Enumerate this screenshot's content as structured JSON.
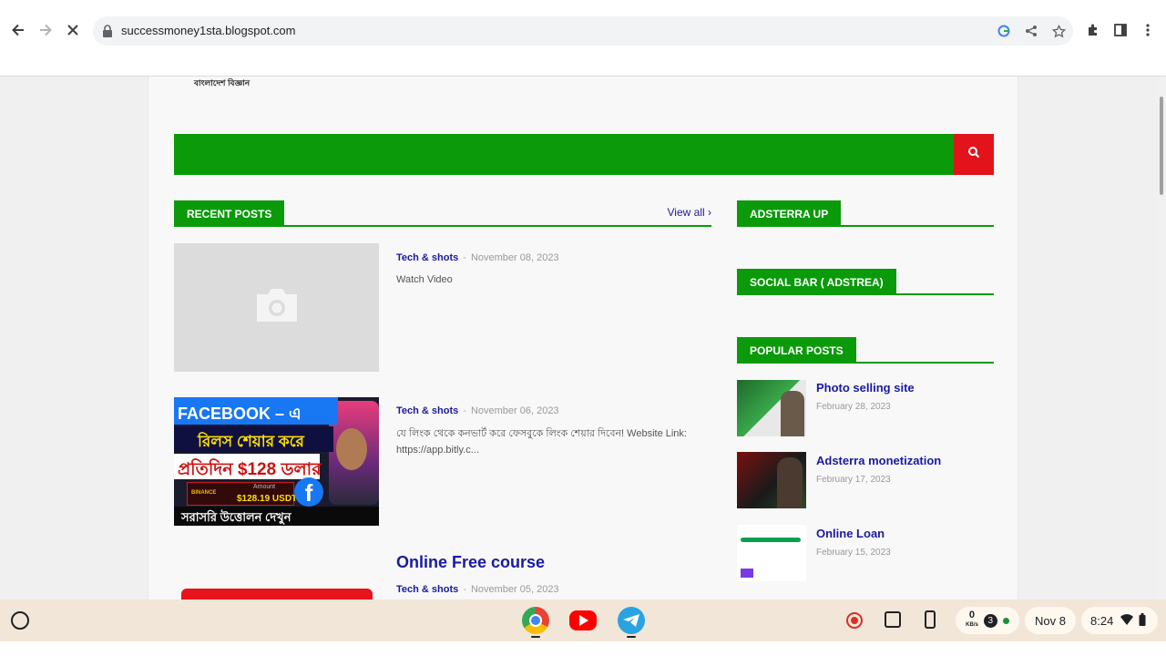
{
  "browser": {
    "url": "successmoney1sta.blogspot.com"
  },
  "site": {
    "logo_text": "বাংলাদেশ বিজ্ঞান"
  },
  "sections": {
    "recent_posts": "RECENT POSTS",
    "view_all": "View all",
    "adsterra_up": "ADSTERRA UP",
    "social_bar": "SOCIAL BAR ( ADSTREA)",
    "popular_posts": "POPULAR POSTS"
  },
  "posts": [
    {
      "category": "Tech & shots",
      "date": "November 08, 2023",
      "snippet": "Watch Video"
    },
    {
      "category": "Tech & shots",
      "date": "November 06, 2023",
      "snippet": "যে লিংক থেকে কনভার্ট করে ফেসবুকে লিংক শেয়ার দিবেন! Website Link: https://app.bitly.c..."
    },
    {
      "title": "Online Free course",
      "category": "Tech & shots",
      "date": "November 05, 2023"
    }
  ],
  "facebook_thumb": {
    "line1": "FACEBOOK – এ",
    "line2": "রিলস শেয়ার করে",
    "line3": "প্রতিদিন $128 ডলার",
    "amount_label": "Amount",
    "amount_brand": "BINANCE",
    "amount_value": "$128.19 USDT",
    "line4": "সরাসরি উত্তোলন দেখুন"
  },
  "popular": [
    {
      "title": "Photo selling site",
      "date": "February 28, 2023"
    },
    {
      "title": "Adsterra monetization",
      "date": "February 17, 2023"
    },
    {
      "title": "Online Loan",
      "date": "February 15, 2023"
    }
  ],
  "taskbar": {
    "net_speed": "0",
    "net_unit": "KB/s",
    "notif_count": "3",
    "date": "Nov 8",
    "time": "8:24"
  },
  "colors": {
    "brand_green": "#0a9a0a",
    "search_red": "#e2131b",
    "link_blue": "#1a1aa0"
  }
}
